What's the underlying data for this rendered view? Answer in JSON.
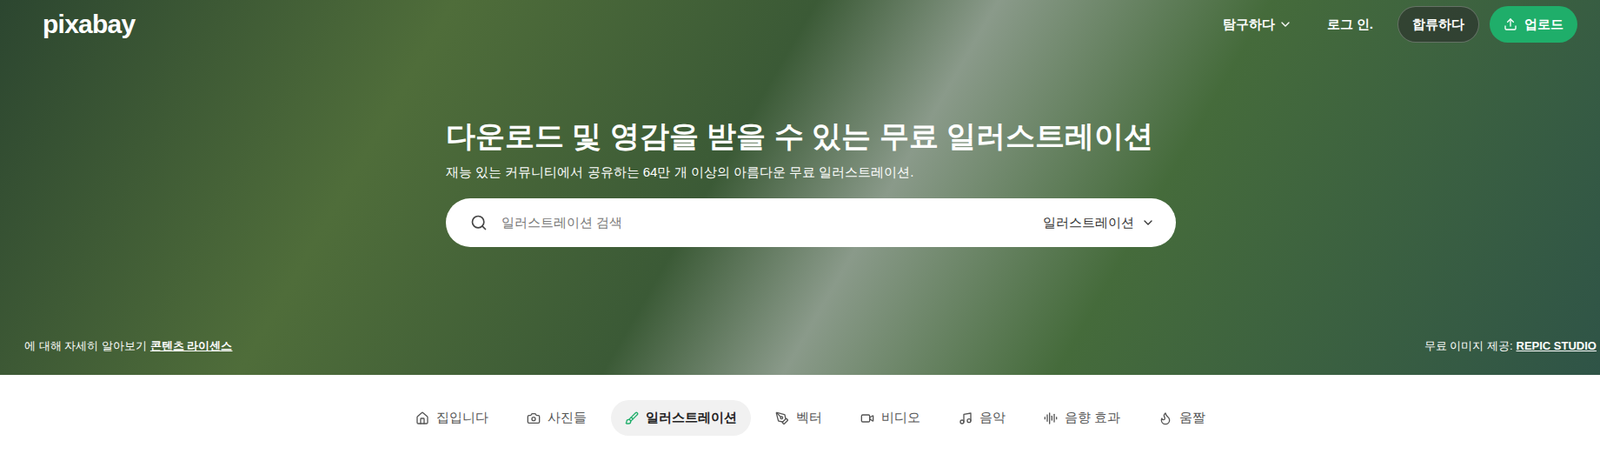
{
  "header": {
    "logo": "pixabay",
    "explore": "탐구하다",
    "login": "로그 인.",
    "join": "합류하다",
    "upload": "업로드"
  },
  "hero": {
    "title": "다운로드 및 영감을 받을 수 있는 무료 일러스트레이션",
    "subtitle": "재능 있는 커뮤니티에서 공유하는 64만 개 이상의 아름다운 무료 일러스트레이션."
  },
  "search": {
    "placeholder": "일러스트레이션 검색",
    "type": "일러스트레이션"
  },
  "license": {
    "text": "에 대해 자세히 알아보기",
    "link": "콘텐츠 라이센스"
  },
  "credit": {
    "label": "무료 이미지 제공:",
    "link": "REPIC STUDIO"
  },
  "tabs": [
    {
      "label": "집입니다",
      "selected": false,
      "icon": "home"
    },
    {
      "label": "사진들",
      "selected": false,
      "icon": "camera"
    },
    {
      "label": "일러스트레이션",
      "selected": true,
      "icon": "brush"
    },
    {
      "label": "벡터",
      "selected": false,
      "icon": "pen"
    },
    {
      "label": "비디오",
      "selected": false,
      "icon": "video"
    },
    {
      "label": "음악",
      "selected": false,
      "icon": "music"
    },
    {
      "label": "음향 효과",
      "selected": false,
      "icon": "audio"
    },
    {
      "label": "움짤",
      "selected": false,
      "icon": "flame"
    }
  ]
}
